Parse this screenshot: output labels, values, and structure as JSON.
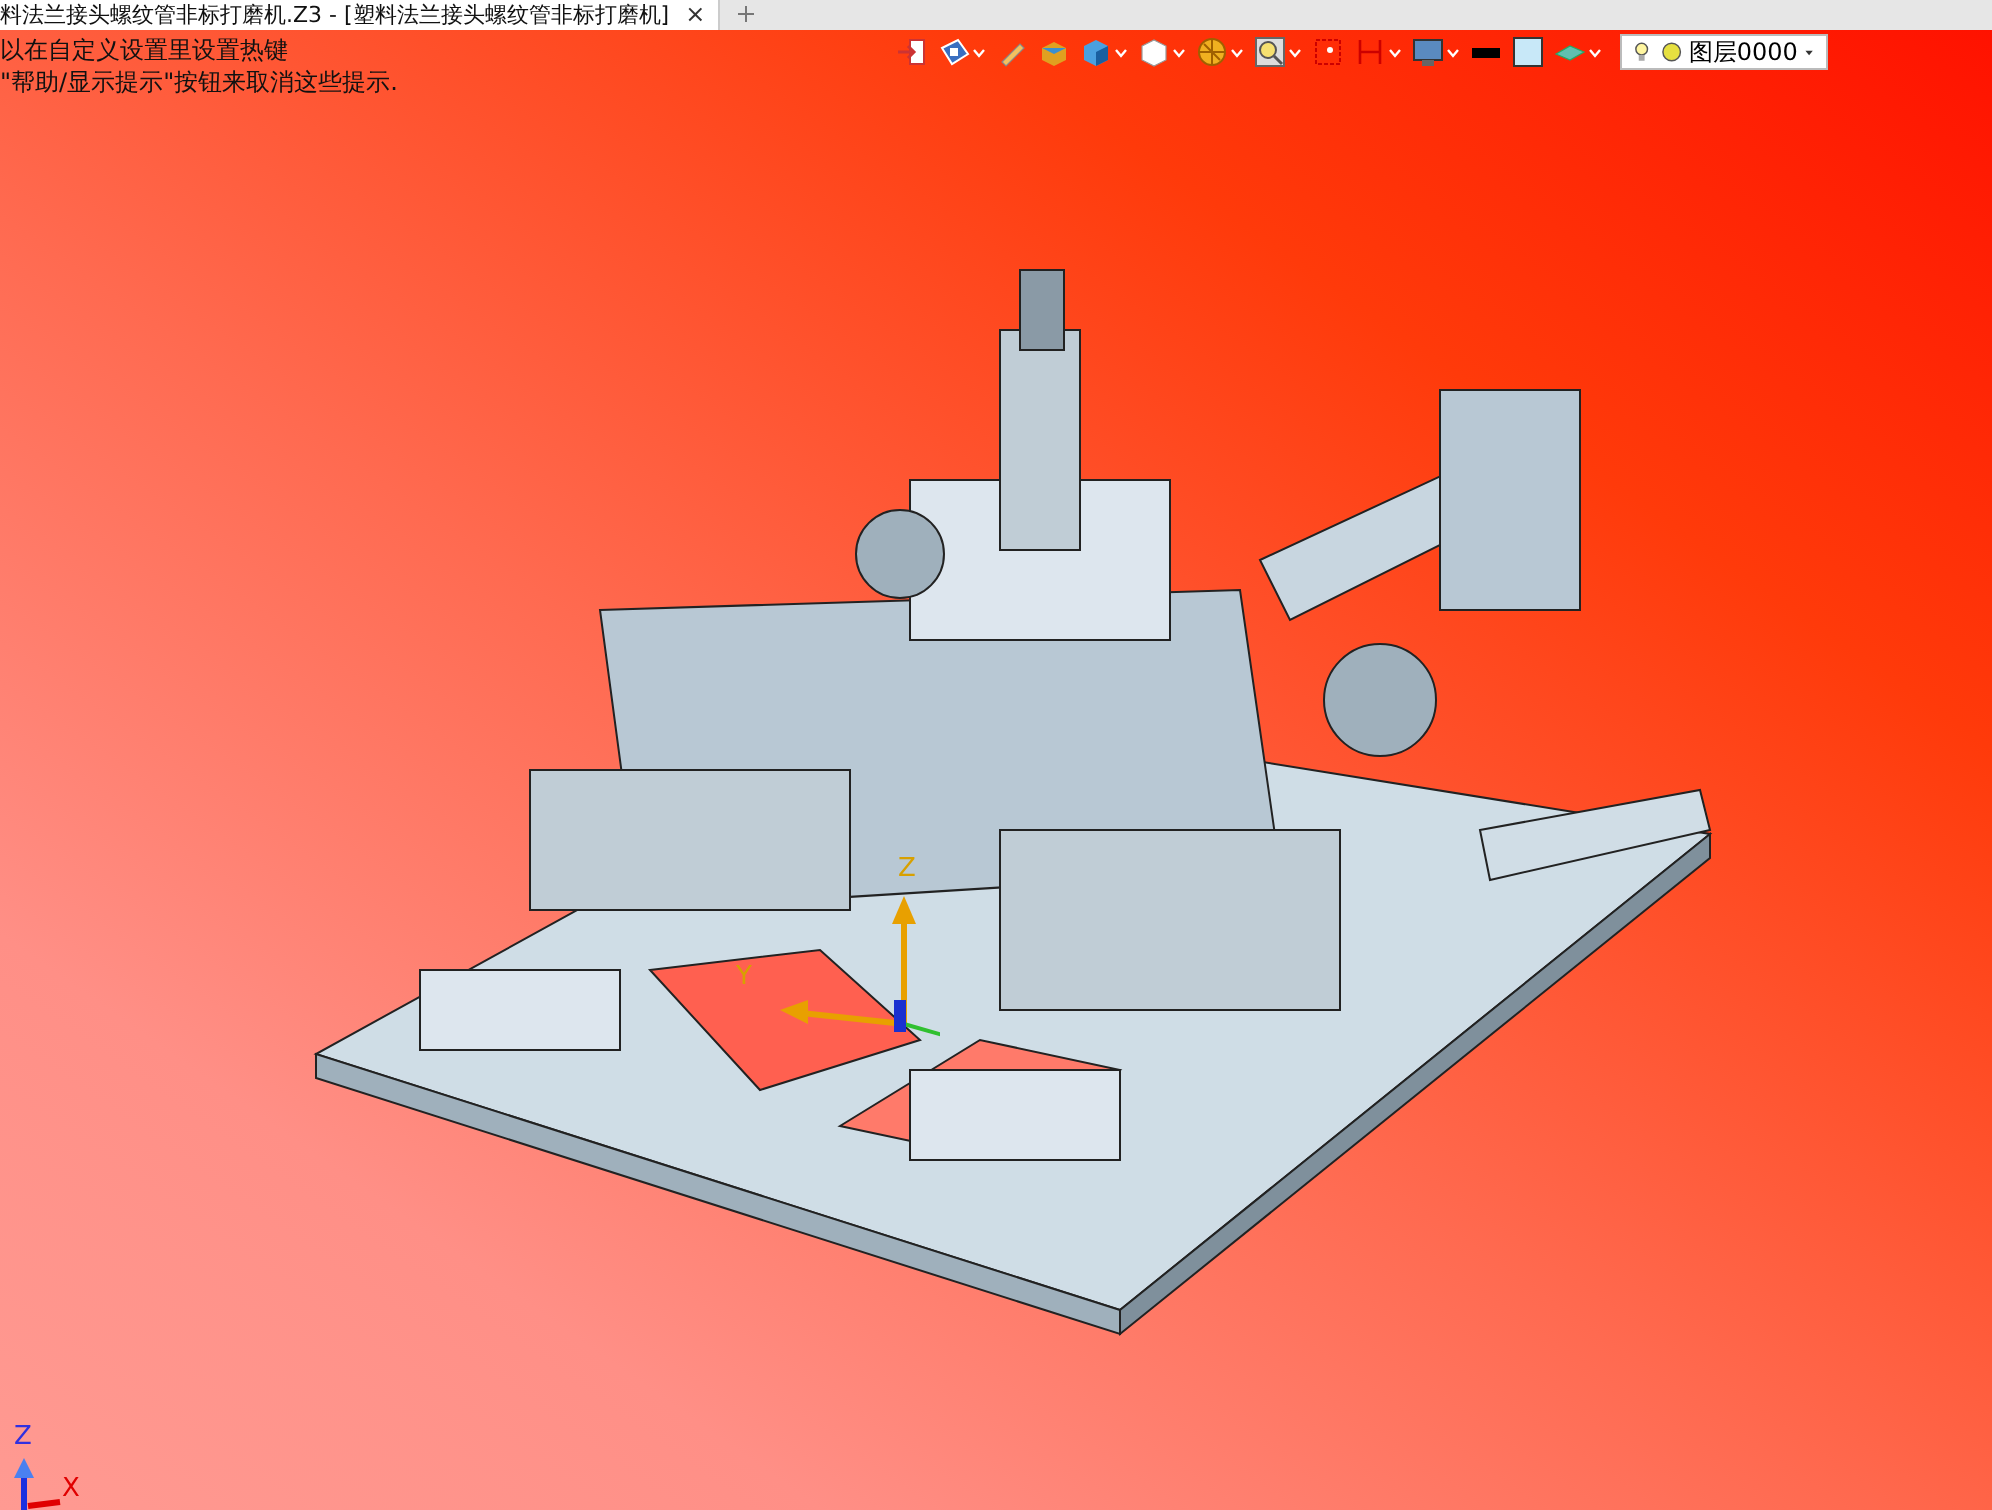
{
  "tab": {
    "title": "料法兰接头螺纹管非标打磨机.Z3 - [塑料法兰接头螺纹管非标打磨机]",
    "close": "×"
  },
  "hints": [
    "以在自定义设置里设置热键",
    "\"帮助/显示提示\"按钮来取消这些提示."
  ],
  "layer_dropdown": {
    "value": "图层0000"
  },
  "triad": {
    "z": "Z",
    "y": "Y"
  },
  "corner_triad": {
    "z": "Z",
    "x": "X"
  }
}
